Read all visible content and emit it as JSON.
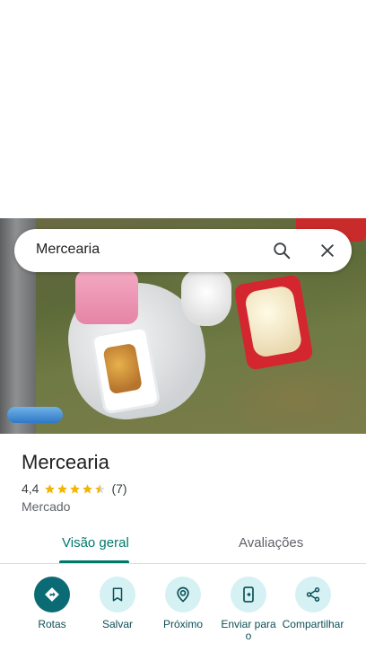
{
  "search": {
    "query": "Mercearia"
  },
  "place": {
    "title": "Mercearia",
    "rating": "4,4",
    "stars": 4.4,
    "reviews_count": "(7)",
    "category": "Mercado"
  },
  "tabs": [
    {
      "label": "Visão geral",
      "selected": true
    },
    {
      "label": "Avaliações",
      "selected": false
    }
  ],
  "actions": [
    {
      "label": "Rotas",
      "icon": "directions-icon"
    },
    {
      "label": "Salvar",
      "icon": "bookmark-icon"
    },
    {
      "label": "Próximo",
      "icon": "nearby-icon"
    },
    {
      "label": "Enviar para o",
      "icon": "send-to-phone-icon"
    },
    {
      "label": "Compartilhar",
      "icon": "share-icon"
    }
  ],
  "colors": {
    "accent": "#00796b",
    "primary_button": "#0b6b75",
    "button_bg": "#d5f1f4",
    "star": "#f4b400"
  }
}
